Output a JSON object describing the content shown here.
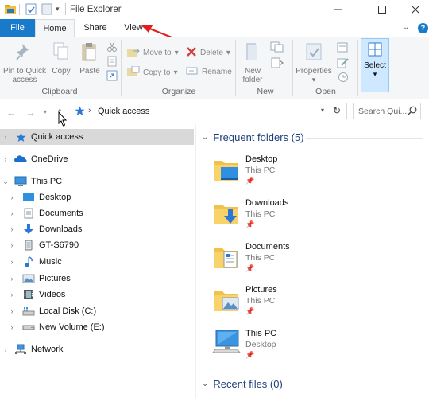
{
  "window": {
    "title": "File Explorer"
  },
  "tabs": [
    {
      "label": "File"
    },
    {
      "label": "Home"
    },
    {
      "label": "Share"
    },
    {
      "label": "View"
    }
  ],
  "ribbon": {
    "clipboard": {
      "pin": "Pin to Quick access",
      "copy": "Copy",
      "paste": "Paste",
      "label": "Clipboard"
    },
    "organize": {
      "move_to": "Move to",
      "copy_to": "Copy to",
      "delete": "Delete",
      "rename": "Rename",
      "label": "Organize"
    },
    "new": {
      "new_folder": "New folder",
      "label": "New"
    },
    "open": {
      "properties": "Properties",
      "label": "Open"
    },
    "select": {
      "select": "Select"
    }
  },
  "address": {
    "path": "Quick access",
    "search_placeholder": "Search Qui..."
  },
  "nav_pane": {
    "quick_access": "Quick access",
    "onedrive": "OneDrive",
    "this_pc": "This PC",
    "children": [
      "Desktop",
      "Documents",
      "Downloads",
      "GT-S6790",
      "Music",
      "Pictures",
      "Videos",
      "Local Disk (C:)",
      "New Volume (E:)"
    ],
    "network": "Network"
  },
  "content": {
    "frequent_header": "Frequent folders (5)",
    "recent_header": "Recent files (0)",
    "folders": [
      {
        "name": "Desktop",
        "location": "This PC"
      },
      {
        "name": "Downloads",
        "location": "This PC"
      },
      {
        "name": "Documents",
        "location": "This PC"
      },
      {
        "name": "Pictures",
        "location": "This PC"
      },
      {
        "name": "This PC",
        "location": "Desktop"
      }
    ]
  },
  "colors": {
    "file_tab": "#1979ca",
    "header_text": "#1e3f7a",
    "selection": "#cde8ff",
    "annotation_arrow": "#e02020"
  }
}
